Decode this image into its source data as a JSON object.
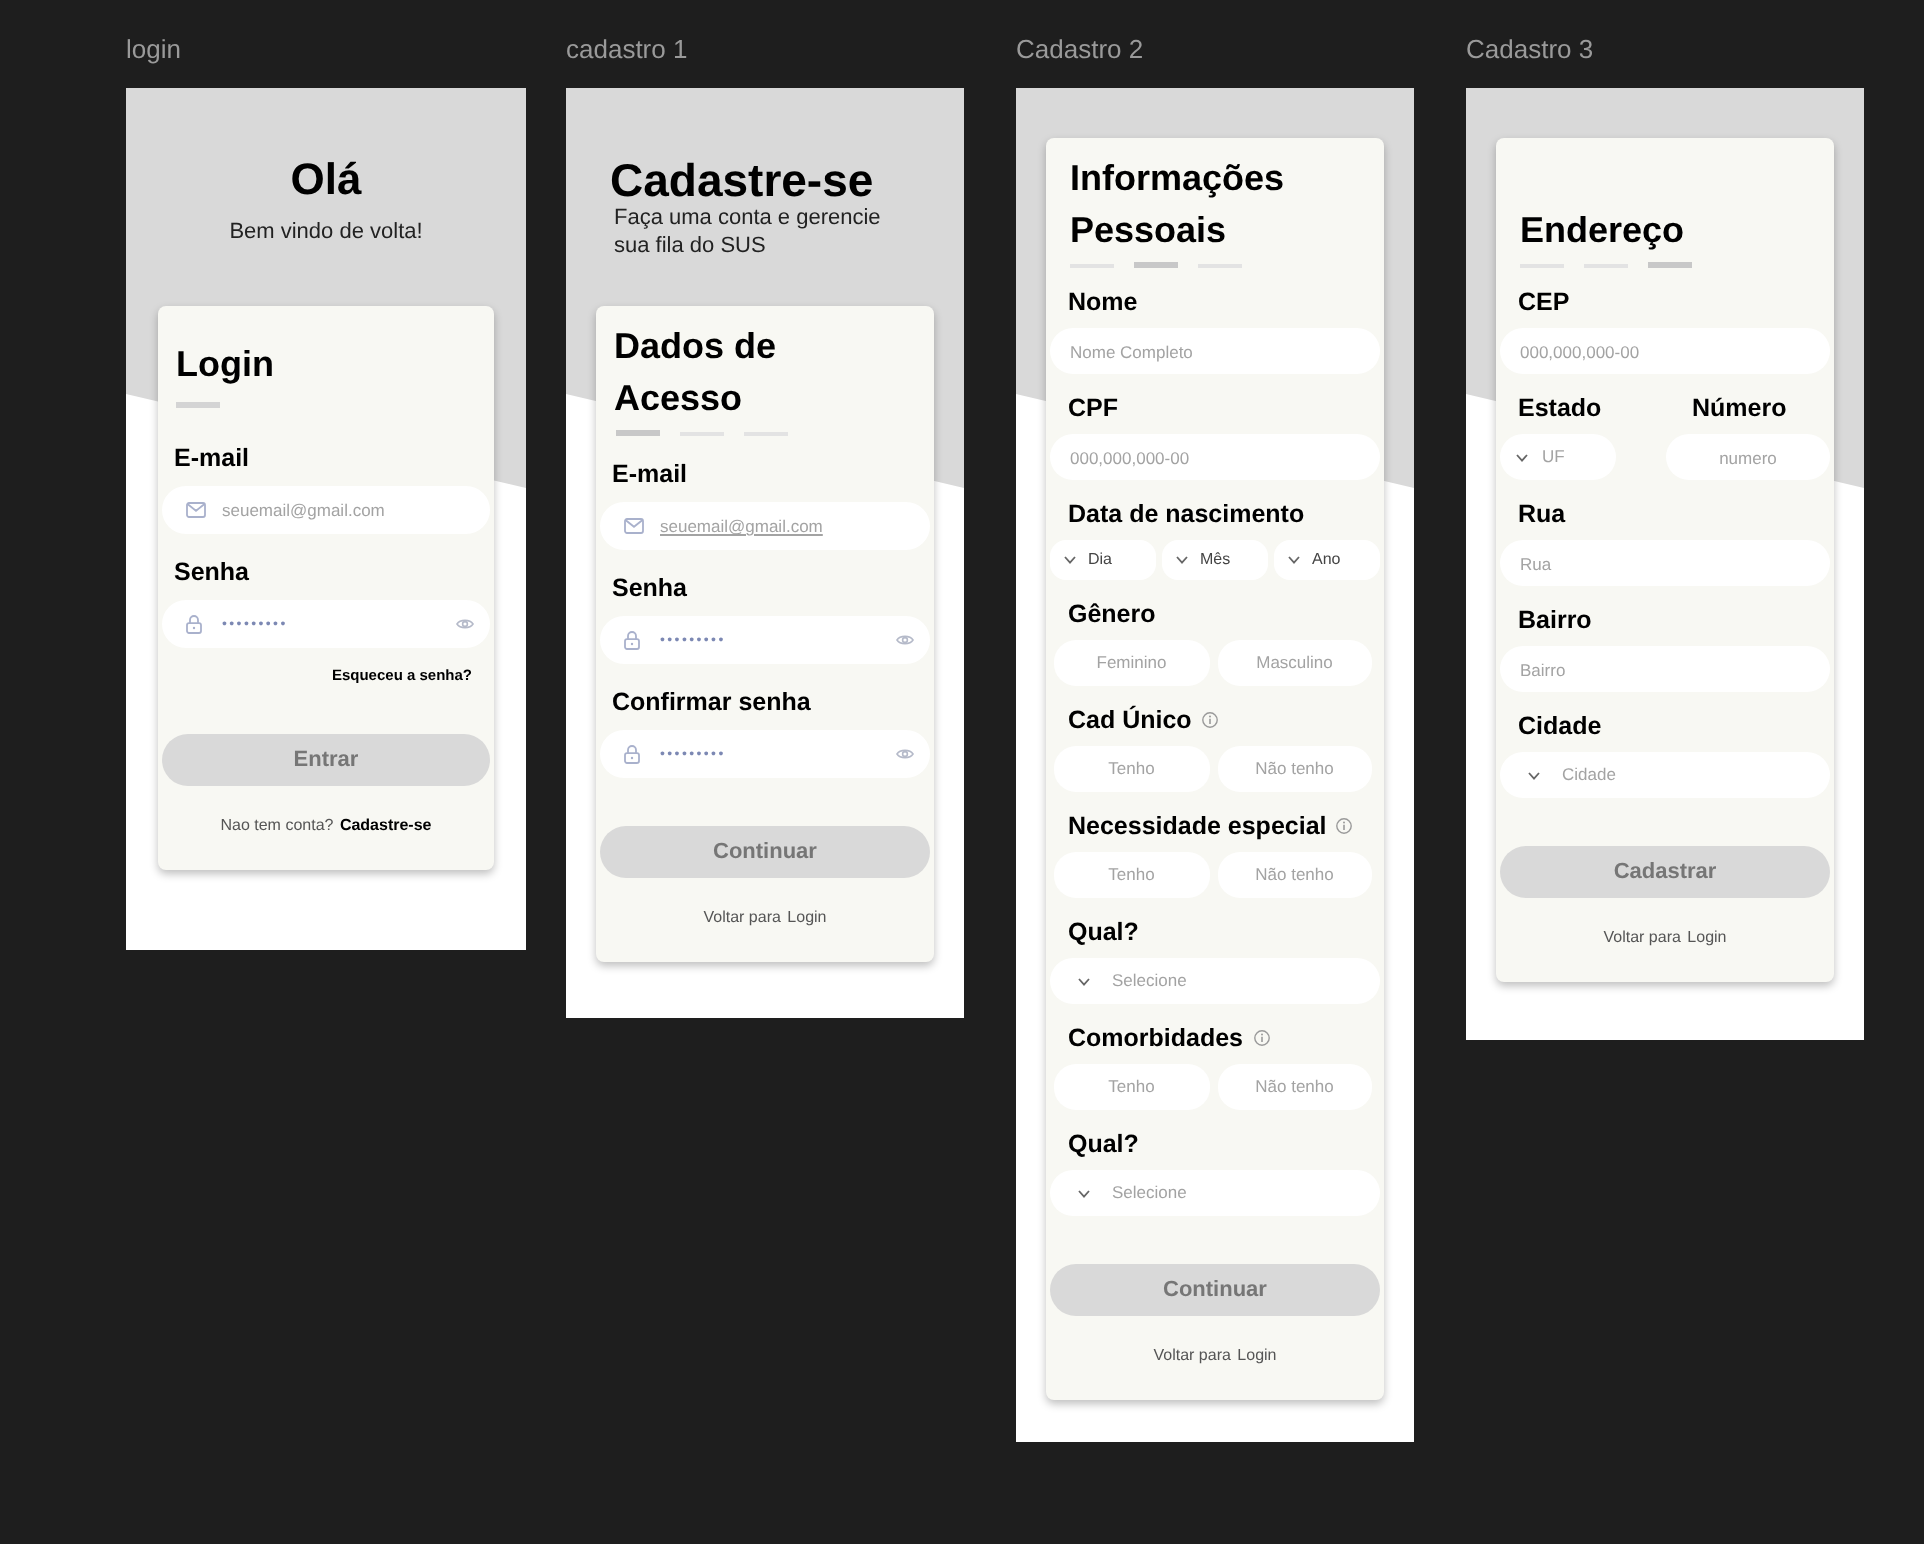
{
  "frames": [
    {
      "kind": "login",
      "label": "login",
      "heading": "Olá",
      "subheading": "Bem vindo de volta!",
      "card": {
        "title": "Login",
        "items": [
          {
            "kind": "email",
            "label": "E-mail",
            "info": false,
            "placeholder": "seuemail@gmail.com",
            "underlined": false
          },
          {
            "kind": "password",
            "label": "Senha",
            "info": false,
            "value": "•••••••••"
          },
          {
            "kind": "link",
            "text": "Esqueceu a senha?"
          }
        ],
        "button": {
          "text": "Entrar",
          "disabled": true
        },
        "footer": {
          "text": "Nao tem conta?",
          "link": "Cadastre-se"
        }
      }
    },
    {
      "kind": "signup",
      "label": "cadastro 1",
      "heading": "Cadastre-se",
      "subheading": "Faça uma conta e gerencie sua fila do SUS",
      "card": {
        "title": "Dados de Acesso",
        "steps": [
          {
            "selected": true
          },
          {
            "selected": false
          },
          {
            "selected": false
          }
        ],
        "items": [
          {
            "kind": "email",
            "label": "E-mail",
            "info": false,
            "placeholder": "seuemail@gmail.com",
            "underlined": true
          },
          {
            "kind": "password",
            "label": "Senha",
            "info": false,
            "value": "•••••••••"
          },
          {
            "kind": "password",
            "label": "Confirmar senha",
            "info": false,
            "value": "•••••••••"
          }
        ],
        "button": {
          "text": "Continuar",
          "disabled": true
        },
        "footer": {
          "text": "Voltar para",
          "link": "Login"
        }
      }
    },
    {
      "kind": "signup",
      "label": "Cadastro 2",
      "card": {
        "title": "Informações Pessoais",
        "steps": [
          {
            "selected": false
          },
          {
            "selected": true
          },
          {
            "selected": false
          }
        ],
        "items": [
          {
            "kind": "text",
            "label": "Nome",
            "info": false,
            "placeholder": "Nome Completo"
          },
          {
            "kind": "text",
            "label": "CPF",
            "info": false,
            "placeholder": "000,000,000-00"
          },
          {
            "kind": "date",
            "label": "Data de nascimento",
            "info": false,
            "selects": [
              "Dia",
              "Mês",
              "Ano"
            ]
          },
          {
            "kind": "choice",
            "label": "Gênero",
            "info": false,
            "options": [
              {
                "text": "Feminino",
                "selected": false
              },
              {
                "text": "Masculino",
                "selected": false
              }
            ]
          },
          {
            "kind": "choice",
            "label": "Cad Único",
            "info": true,
            "options": [
              {
                "text": "Tenho",
                "selected": false
              },
              {
                "text": "Não tenho",
                "selected": false
              }
            ]
          },
          {
            "kind": "choice",
            "label": "Necessidade especial",
            "info": true,
            "options": [
              {
                "text": "Tenho",
                "selected": false
              },
              {
                "text": "Não tenho",
                "selected": false
              }
            ]
          },
          {
            "kind": "select",
            "label": "Qual?",
            "info": false,
            "placeholder": "Selecione"
          },
          {
            "kind": "choice",
            "label": "Comorbidades",
            "info": true,
            "options": [
              {
                "text": "Tenho",
                "selected": false
              },
              {
                "text": "Não tenho",
                "selected": false
              }
            ]
          },
          {
            "kind": "select",
            "label": "Qual?",
            "info": false,
            "placeholder": "Selecione"
          }
        ],
        "button": {
          "text": "Continuar",
          "disabled": true
        },
        "footer": {
          "text": "Voltar para",
          "link": "Login"
        }
      }
    },
    {
      "kind": "signup",
      "label": "Cadastro 3",
      "card": {
        "title": "Endereço",
        "steps": [
          {
            "selected": false
          },
          {
            "selected": false
          },
          {
            "selected": true
          }
        ],
        "items": [
          {
            "kind": "text",
            "label": "CEP",
            "info": false,
            "placeholder": "000,000,000-00"
          },
          {
            "kind": "pair",
            "columns": [
              {
                "kind": "select",
                "label": "Estado",
                "info": false,
                "placeholder": "UF"
              },
              {
                "kind": "text",
                "label": "Número",
                "info": false,
                "placeholder": "numero"
              }
            ]
          },
          {
            "kind": "text",
            "label": "Rua",
            "info": false,
            "placeholder": "Rua"
          },
          {
            "kind": "text",
            "label": "Bairro",
            "info": false,
            "placeholder": "Bairro"
          },
          {
            "kind": "select",
            "label": "Cidade",
            "info": false,
            "placeholder": "Cidade"
          }
        ],
        "button": {
          "text": "Cadastrar",
          "disabled": true
        },
        "footer": {
          "text": "Voltar para",
          "link": "Login"
        }
      }
    }
  ]
}
